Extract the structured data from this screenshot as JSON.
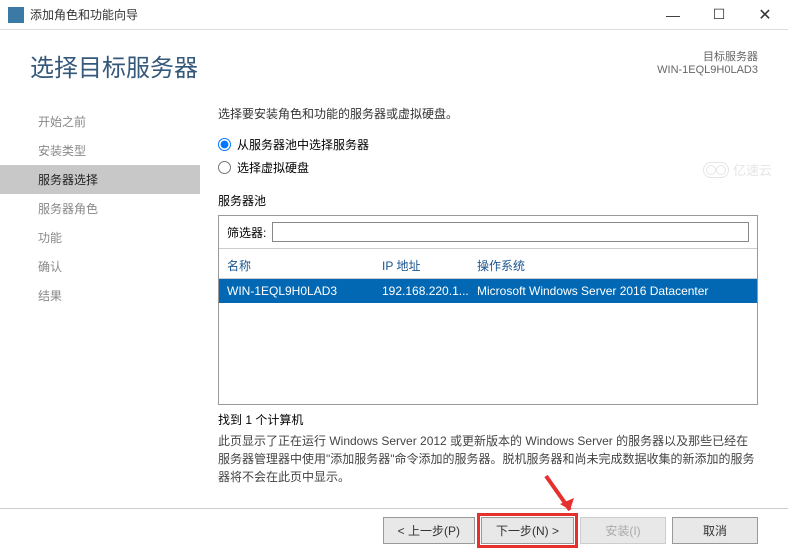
{
  "titlebar": {
    "title": "添加角色和功能向导"
  },
  "header": {
    "title": "选择目标服务器",
    "target_label": "目标服务器",
    "target_value": "WIN-1EQL9H0LAD3"
  },
  "sidebar": {
    "items": [
      {
        "label": "开始之前"
      },
      {
        "label": "安装类型"
      },
      {
        "label": "服务器选择"
      },
      {
        "label": "服务器角色"
      },
      {
        "label": "功能"
      },
      {
        "label": "确认"
      },
      {
        "label": "结果"
      }
    ],
    "active_index": 2
  },
  "main": {
    "instruction": "选择要安装角色和功能的服务器或虚拟硬盘。",
    "radio1": "从服务器池中选择服务器",
    "radio2": "选择虚拟硬盘",
    "pool_label": "服务器池",
    "filter_label": "筛选器:",
    "filter_value": "",
    "columns": {
      "name": "名称",
      "ip": "IP 地址",
      "os": "操作系统"
    },
    "rows": [
      {
        "name": "WIN-1EQL9H0LAD3",
        "ip": "192.168.220.1...",
        "os": "Microsoft Windows Server 2016 Datacenter"
      }
    ],
    "count": "找到 1 个计算机",
    "description": "此页显示了正在运行 Windows Server 2012 或更新版本的 Windows Server 的服务器以及那些已经在服务器管理器中使用\"添加服务器\"命令添加的服务器。脱机服务器和尚未完成数据收集的新添加的服务器将不会在此页中显示。"
  },
  "footer": {
    "prev": "< 上一步(P)",
    "next": "下一步(N) >",
    "install": "安装(I)",
    "cancel": "取消"
  },
  "watermark": "亿速云"
}
